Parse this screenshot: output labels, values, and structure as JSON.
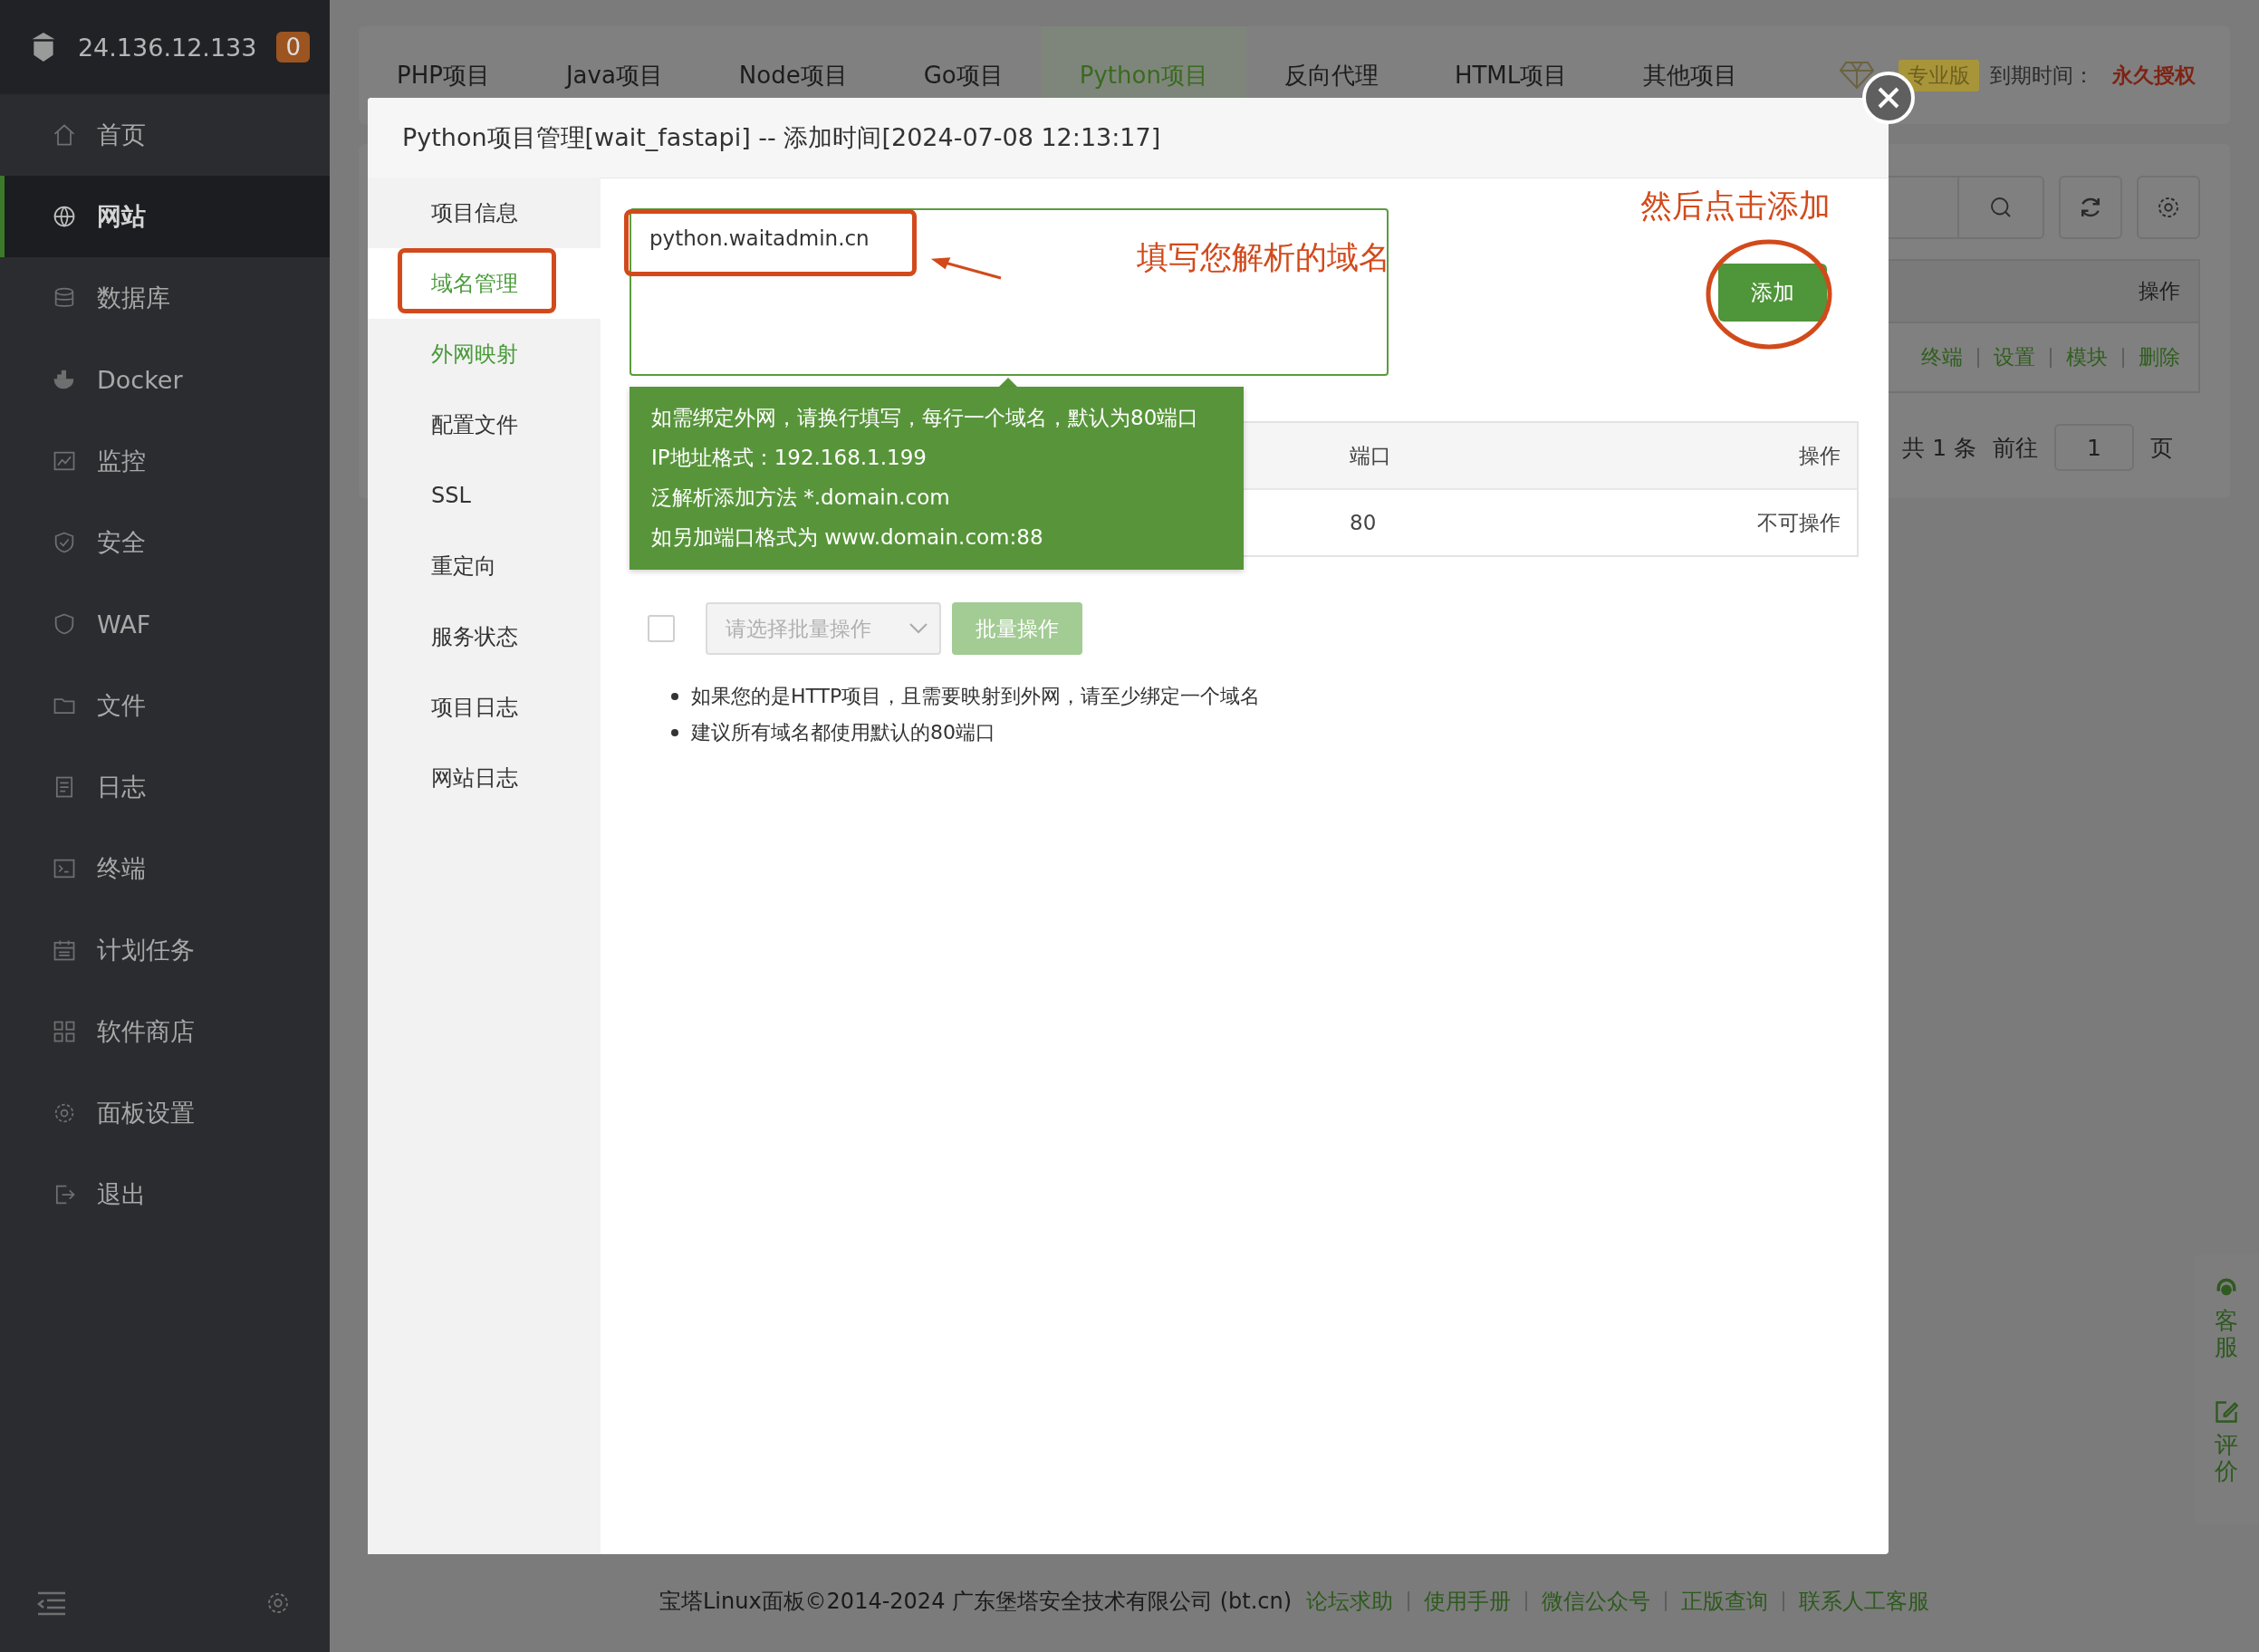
{
  "sidebar": {
    "server_ip": "24.136.12.133",
    "badge": "0",
    "items": [
      {
        "label": "首页",
        "selected": false
      },
      {
        "label": "网站",
        "selected": true
      },
      {
        "label": "数据库",
        "selected": false
      },
      {
        "label": "Docker",
        "selected": false
      },
      {
        "label": "监控",
        "selected": false
      },
      {
        "label": "安全",
        "selected": false
      },
      {
        "label": "WAF",
        "selected": false
      },
      {
        "label": "文件",
        "selected": false
      },
      {
        "label": "日志",
        "selected": false
      },
      {
        "label": "终端",
        "selected": false
      },
      {
        "label": "计划任务",
        "selected": false
      },
      {
        "label": "软件商店",
        "selected": false
      },
      {
        "label": "面板设置",
        "selected": false
      },
      {
        "label": "退出",
        "selected": false
      }
    ]
  },
  "tabs": [
    {
      "label": "PHP项目",
      "selected": false
    },
    {
      "label": "Java项目",
      "selected": false
    },
    {
      "label": "Node项目",
      "selected": false
    },
    {
      "label": "Go项目",
      "selected": false
    },
    {
      "label": "Python项目",
      "selected": true
    },
    {
      "label": "反向代理",
      "selected": false
    },
    {
      "label": "HTML项目",
      "selected": false
    },
    {
      "label": "其他项目",
      "selected": false
    }
  ],
  "license": {
    "edition": "专业版",
    "expiry_label": "到期时间：",
    "expiry_value": "永久授权"
  },
  "site_list": {
    "column": "操作",
    "row_actions": [
      "终端",
      "设置",
      "模块",
      "删除"
    ],
    "pagination": {
      "total": "共 1 条",
      "goto_label": "前往",
      "page": "1",
      "page_suffix": "页"
    }
  },
  "modal": {
    "title": "Python项目管理[wait_fastapi] -- 添加时间[2024-07-08 12:13:17]",
    "nav": [
      {
        "label": "项目信息",
        "selected": false,
        "accent": false
      },
      {
        "label": "域名管理",
        "selected": true,
        "accent": false
      },
      {
        "label": "外网映射",
        "selected": false,
        "accent": true
      },
      {
        "label": "配置文件",
        "selected": false,
        "accent": false
      },
      {
        "label": "SSL",
        "selected": false,
        "accent": false
      },
      {
        "label": "重定向",
        "selected": false,
        "accent": false
      },
      {
        "label": "服务状态",
        "selected": false,
        "accent": false
      },
      {
        "label": "项目日志",
        "selected": false,
        "accent": false
      },
      {
        "label": "网站日志",
        "selected": false,
        "accent": false
      }
    ],
    "domain_input": {
      "value": "python.waitadmin.cn"
    },
    "add_button": "添加",
    "hint_lines": [
      "如需绑定外网，请换行填写，每行一个域名，默认为80端口",
      "IP地址格式：192.168.1.199",
      "泛解析添加方法 *.domain.com",
      "如另加端口格式为 www.domain.com:88"
    ],
    "table": {
      "columns": [
        "端口",
        "操作"
      ],
      "rows": [
        {
          "port": "80",
          "action": "不可操作"
        }
      ]
    },
    "batch": {
      "checked": false,
      "placeholder": "请选择批量操作",
      "button": "批量操作",
      "disabled": true
    },
    "notes": [
      "如果您的是HTTP项目，且需要映射到外网，请至少绑定一个域名",
      "建议所有域名都使用默认的80端口"
    ]
  },
  "annotations": {
    "input_hint": "填写您解析的域名",
    "button_hint": "然后点击添加"
  },
  "footer": {
    "copyright": "宝塔Linux面板©2014-2024 广东堡塔安全技术有限公司 (bt.cn)",
    "links": [
      "论坛求助",
      "使用手册",
      "微信公众号",
      "正版查询",
      "联系人工客服"
    ]
  },
  "support_widget": {
    "items": [
      "客服",
      "评价"
    ]
  }
}
